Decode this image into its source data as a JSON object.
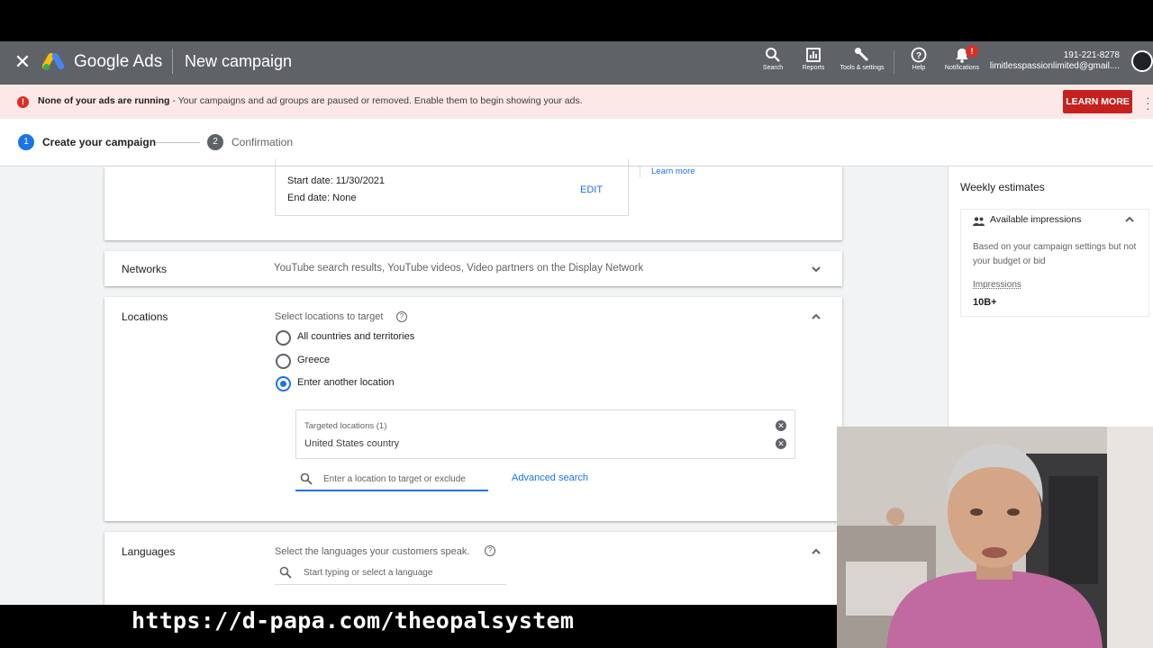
{
  "header": {
    "brand": "Google Ads",
    "page_title": "New campaign",
    "buttons": [
      {
        "label": "Search",
        "icon": "search-icon"
      },
      {
        "label": "Reports",
        "icon": "reports-icon"
      },
      {
        "label": "Tools & settings",
        "icon": "wrench-icon"
      },
      {
        "label": "Help",
        "icon": "help-icon"
      },
      {
        "label": "Notifications",
        "icon": "bell-icon"
      }
    ],
    "notification_badge": "!",
    "account_id": "191-221-8278",
    "account_email": "limitlesspassionlimited@gmail...."
  },
  "banner": {
    "bold_text": "None of your ads are running",
    "text": " - Your campaigns and ad groups are paused or removed. Enable them to begin showing your ads.",
    "button": "LEARN MORE"
  },
  "stepper": {
    "steps": [
      {
        "num": "1",
        "label": "Create your campaign"
      },
      {
        "num": "2",
        "label": "Confirmation"
      }
    ]
  },
  "dates": {
    "start": "Start date: 11/30/2021",
    "end": "End date: None",
    "edit": "EDIT",
    "learn_more": "Learn more"
  },
  "networks": {
    "label": "Networks",
    "summary": "YouTube search results, YouTube videos, Video partners on the Display Network"
  },
  "locations": {
    "label": "Locations",
    "prompt": "Select locations to target",
    "options": [
      "All countries and territories",
      "Greece",
      "Enter another location"
    ],
    "selected_index": 2,
    "targeted_header": "Targeted locations (1)",
    "targeted_item": "United States country",
    "search_placeholder": "Enter a location to target or exclude",
    "advanced_search": "Advanced search"
  },
  "languages": {
    "label": "Languages",
    "prompt": "Select the languages your customers speak.",
    "search_placeholder": "Start typing or select a language"
  },
  "estimates": {
    "title": "Weekly estimates",
    "section": "Available impressions",
    "description": "Based on your campaign settings but not your budget or bid",
    "metric_label": "Impressions",
    "metric_value": "10B+"
  },
  "overlay": {
    "url": "https://d-papa.com/theopalsystem"
  },
  "colors": {
    "header_bg": "#5f6368",
    "accent": "#1a73e8",
    "error": "#d93025",
    "banner_bg": "#fce8e6"
  }
}
